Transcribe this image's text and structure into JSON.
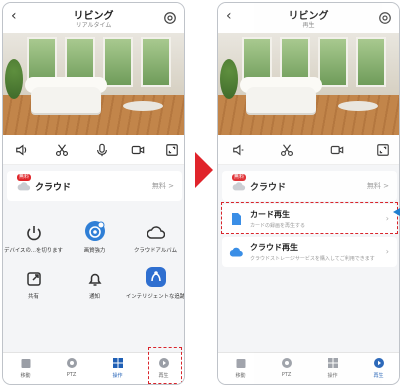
{
  "left": {
    "title": "リビング",
    "subtitle": "リアルタイム",
    "cloud": {
      "badge": "無料",
      "label": "クラウド",
      "value": "無料 >"
    },
    "grid": [
      {
        "label": "デバイスの...を切ります",
        "icon": "power-icon"
      },
      {
        "label": "画質強力",
        "icon": "enhance-icon"
      },
      {
        "label": "クラウドアルバム",
        "icon": "cloud-album-icon"
      },
      {
        "label": "共有",
        "icon": "share-icon"
      },
      {
        "label": "通知",
        "icon": "bell-icon"
      },
      {
        "label": "インテリジェントな追跡",
        "icon": "tracking-icon"
      }
    ],
    "tabs": [
      "移動",
      "PTZ",
      "操作",
      "再生"
    ]
  },
  "right": {
    "title": "リビング",
    "subtitle": "再生",
    "cloud": {
      "badge": "無料",
      "label": "クラウド",
      "value": "無料 >"
    },
    "list": [
      {
        "title": "カード再生",
        "desc": "カードの録画を再生する"
      },
      {
        "title": "クラウド再生",
        "desc": "クラウドストレージサービスを購入してご利用できます"
      }
    ],
    "tabs": [
      "移動",
      "PTZ",
      "操作",
      "再生"
    ]
  },
  "colors": {
    "accent": "#1f5fb5",
    "highlight": "#d9242b",
    "arrow": "#e0242b"
  }
}
